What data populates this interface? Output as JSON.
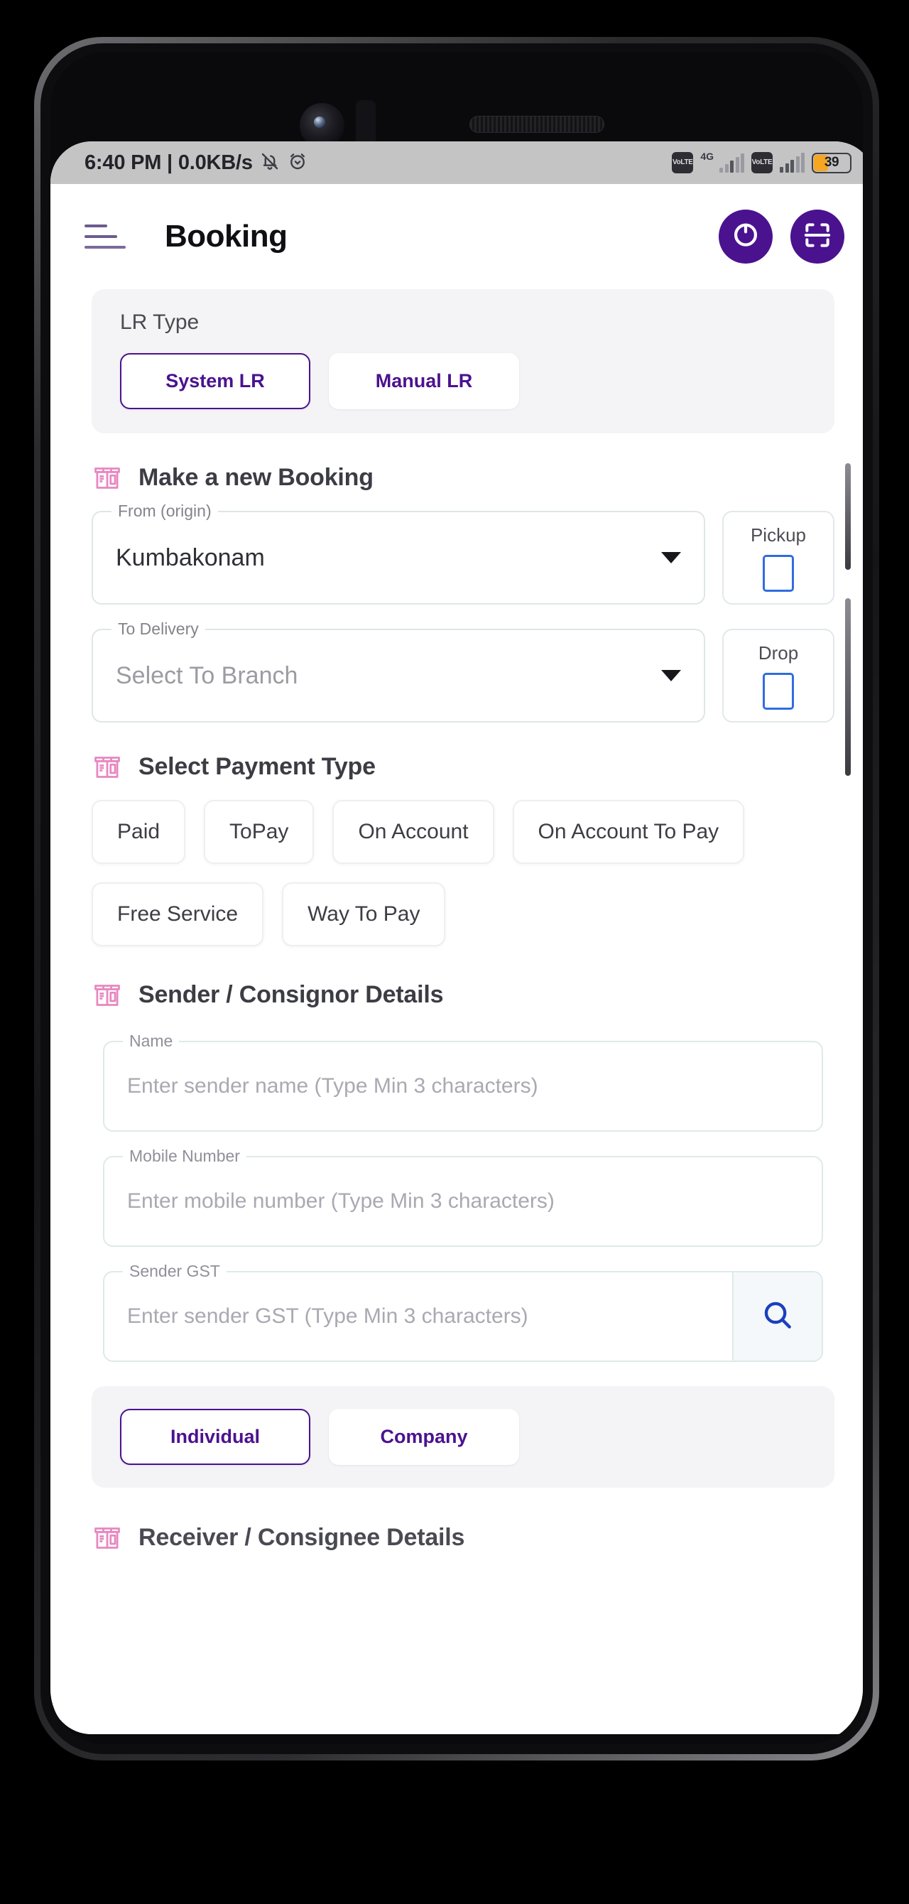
{
  "statusbar": {
    "clock": "6:40 PM | 0.0KB/s",
    "mute_icon": "bell-muted-icon",
    "alarm_icon": "alarm-clock-icon",
    "volte1": "VoLTE",
    "volte2": "VoLTE",
    "network_tag": "4G",
    "battery_percent": "39",
    "battery_color": "#f5a623"
  },
  "appbar": {
    "menu_icon": "hamburger-menu-icon",
    "title": "Booking",
    "refresh_icon": "refresh-icon",
    "scan_icon": "scan-barcode-icon",
    "accent": "#4b128f"
  },
  "lr_type": {
    "label": "LR Type",
    "options": [
      {
        "label": "System LR",
        "selected": true
      },
      {
        "label": "Manual LR",
        "selected": false
      }
    ]
  },
  "booking": {
    "icon": "package-box-icon",
    "title": "Make a new Booking",
    "from": {
      "legend": "From (origin)",
      "value": "Kumbakonam",
      "side_label": "Pickup",
      "checked": false
    },
    "to": {
      "legend": "To Delivery",
      "value": "Select To Branch",
      "side_label": "Drop",
      "checked": false
    }
  },
  "payment": {
    "icon": "package-box-icon",
    "title": "Select Payment Type",
    "options": [
      "Paid",
      "ToPay",
      "On Account",
      "On Account To Pay",
      "Free Service",
      "Way To Pay"
    ]
  },
  "sender": {
    "icon": "package-box-icon",
    "title": "Sender / Consignor Details",
    "fields": [
      {
        "legend": "Name",
        "placeholder": "Enter sender name (Type Min 3 characters)",
        "value": ""
      },
      {
        "legend": "Mobile Number",
        "placeholder": "Enter mobile number (Type Min 3 characters)",
        "value": ""
      },
      {
        "legend": "Sender GST",
        "placeholder": "Enter sender GST (Type Min 3 characters)",
        "value": ""
      }
    ],
    "search_icon": "search-icon",
    "entity_options": [
      {
        "label": "Individual",
        "selected": true
      },
      {
        "label": "Company",
        "selected": false
      }
    ]
  },
  "receiver": {
    "icon": "package-box-icon",
    "title": "Receiver / Consignee Details"
  }
}
